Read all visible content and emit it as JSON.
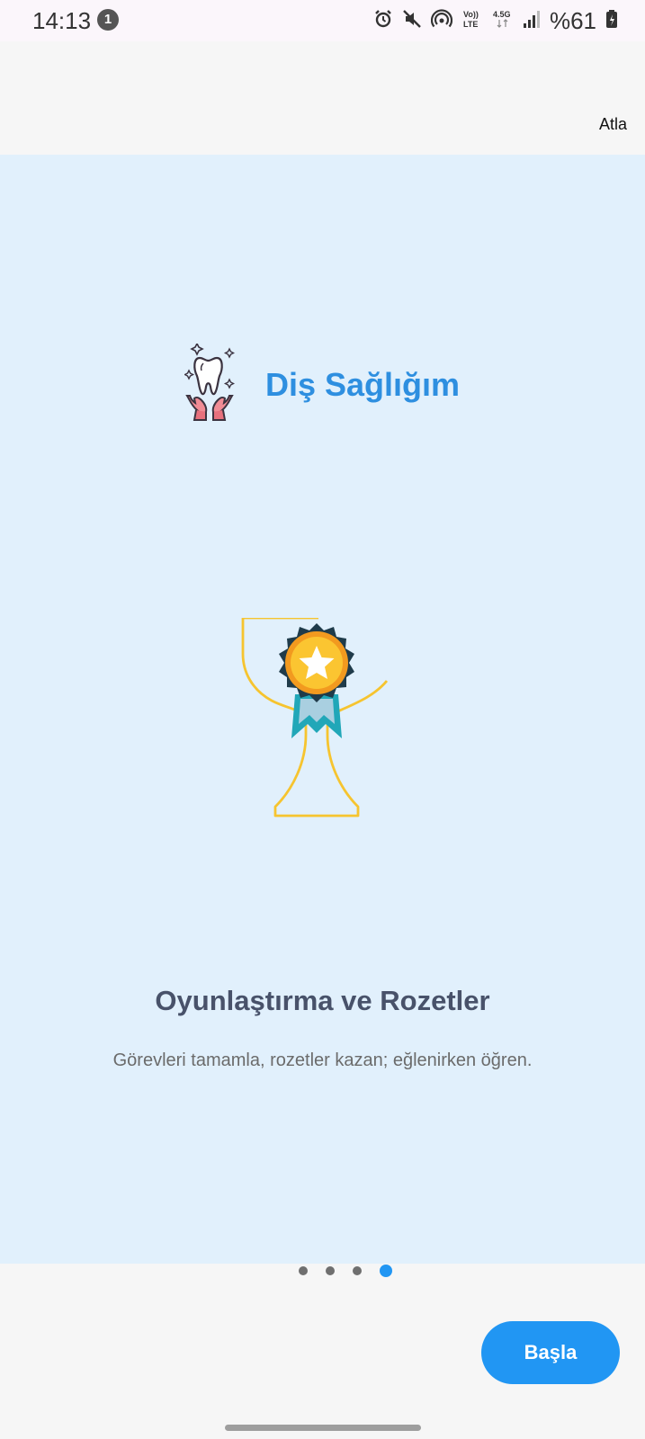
{
  "status_bar": {
    "time": "14:13",
    "notification_count": "1",
    "battery": "%61",
    "icons": [
      "alarm-icon",
      "mute-icon",
      "hotspot-icon",
      "volte-icon",
      "network-4-5g-icon",
      "signal-icon",
      "battery-icon"
    ]
  },
  "header": {
    "skip_label": "Atla"
  },
  "brand": {
    "title": "Diş Sağlığım",
    "logo_icon": "tooth-hands-icon"
  },
  "slide": {
    "illustration_icon": "trophy-badge-icon",
    "title": "Oyunlaştırma ve Rozetler",
    "description": "Görevleri tamamla, rozetler kazan; eğlenirken öğren."
  },
  "pagination": {
    "total": 4,
    "active_index": 3
  },
  "footer": {
    "start_label": "Başla"
  },
  "colors": {
    "accent": "#2196f3",
    "brand_text": "#2e8fe0",
    "slide_bg": "#e1f0fc",
    "title_text": "#48526a"
  }
}
